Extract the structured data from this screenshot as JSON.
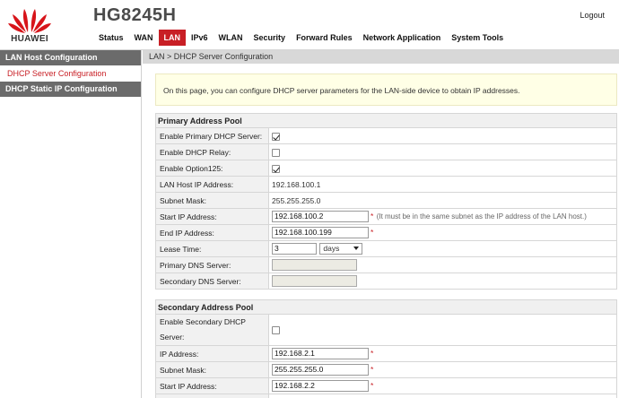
{
  "header": {
    "brand": "HUAWEI",
    "model": "HG8245H",
    "logout": "Logout",
    "nav": [
      "Status",
      "WAN",
      "LAN",
      "IPv6",
      "WLAN",
      "Security",
      "Forward Rules",
      "Network Application",
      "System Tools"
    ],
    "active_nav": "LAN",
    "brand_color": "#c81f25"
  },
  "sidebar": {
    "section1": "LAN Host Configuration",
    "item_active": "DHCP Server Configuration",
    "section2": "DHCP Static IP Configuration"
  },
  "breadcrumb": "LAN > DHCP Server Configuration",
  "info": "On this page, you can configure DHCP server parameters for the LAN-side device to obtain IP addresses.",
  "primary": {
    "title": "Primary Address Pool",
    "enable_primary_label": "Enable Primary DHCP Server:",
    "enable_primary": true,
    "enable_relay_label": "Enable DHCP Relay:",
    "enable_relay": false,
    "enable_opt125_label": "Enable Option125:",
    "enable_opt125": true,
    "lan_ip_label": "LAN Host IP Address:",
    "lan_ip": "192.168.100.1",
    "subnet_label": "Subnet Mask:",
    "subnet": "255.255.255.0",
    "start_ip_label": "Start IP Address:",
    "start_ip": "192.168.100.2",
    "start_hint": "(It must be in the same subnet as the IP address of the LAN host.)",
    "end_ip_label": "End IP Address:",
    "end_ip": "192.168.100.199",
    "lease_label": "Lease Time:",
    "lease_value": "3",
    "lease_unit": "days",
    "dns1_label": "Primary DNS Server:",
    "dns1": "",
    "dns2_label": "Secondary DNS Server:",
    "dns2": "",
    "required_mark": "*"
  },
  "secondary": {
    "title": "Secondary Address Pool",
    "enable_label_line1": "Enable Secondary DHCP",
    "enable_label_line2": "Server:",
    "enable": false,
    "ip_label": "IP Address:",
    "ip": "192.168.2.1",
    "subnet_label": "Subnet Mask:",
    "subnet": "255.255.255.0",
    "start_ip_label": "Start IP Address:",
    "start_ip": "192.168.2.2",
    "required_mark": "*"
  }
}
